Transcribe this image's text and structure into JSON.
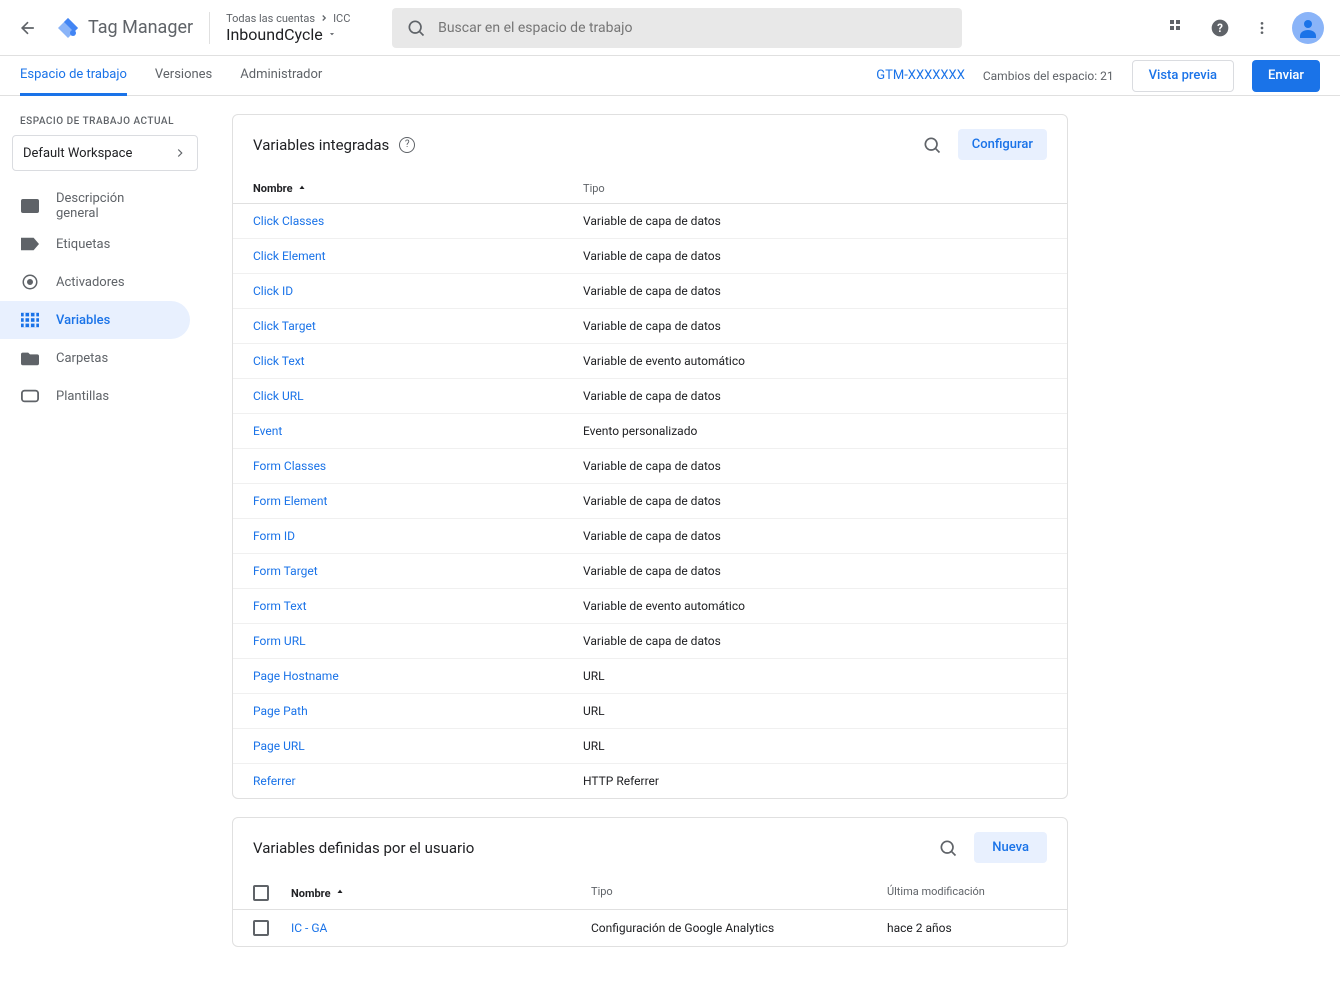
{
  "header": {
    "app_name": "Tag Manager",
    "breadcrumb_all": "Todas las cuentas",
    "breadcrumb_account": "ICC",
    "container_name": "InboundCycle",
    "search_placeholder": "Buscar en el espacio de trabajo"
  },
  "tabs": {
    "workspace": "Espacio de trabajo",
    "versions": "Versiones",
    "admin": "Administrador"
  },
  "subheader": {
    "container_id": "GTM-XXXXXXX",
    "changes_label": "Cambios del espacio: 21",
    "preview": "Vista previa",
    "submit": "Enviar"
  },
  "sidebar": {
    "ws_label": "ESPACIO DE TRABAJO ACTUAL",
    "ws_name": "Default Workspace",
    "items": [
      {
        "label": "Descripción general"
      },
      {
        "label": "Etiquetas"
      },
      {
        "label": "Activadores"
      },
      {
        "label": "Variables"
      },
      {
        "label": "Carpetas"
      },
      {
        "label": "Plantillas"
      }
    ]
  },
  "builtin": {
    "title": "Variables integradas",
    "configure": "Configurar",
    "cols": {
      "name": "Nombre",
      "type": "Tipo"
    },
    "rows": [
      {
        "name": "Click Classes",
        "type": "Variable de capa de datos"
      },
      {
        "name": "Click Element",
        "type": "Variable de capa de datos"
      },
      {
        "name": "Click ID",
        "type": "Variable de capa de datos"
      },
      {
        "name": "Click Target",
        "type": "Variable de capa de datos"
      },
      {
        "name": "Click Text",
        "type": "Variable de evento automático"
      },
      {
        "name": "Click URL",
        "type": "Variable de capa de datos"
      },
      {
        "name": "Event",
        "type": "Evento personalizado"
      },
      {
        "name": "Form Classes",
        "type": "Variable de capa de datos"
      },
      {
        "name": "Form Element",
        "type": "Variable de capa de datos"
      },
      {
        "name": "Form ID",
        "type": "Variable de capa de datos"
      },
      {
        "name": "Form Target",
        "type": "Variable de capa de datos"
      },
      {
        "name": "Form Text",
        "type": "Variable de evento automático"
      },
      {
        "name": "Form URL",
        "type": "Variable de capa de datos"
      },
      {
        "name": "Page Hostname",
        "type": "URL"
      },
      {
        "name": "Page Path",
        "type": "URL"
      },
      {
        "name": "Page URL",
        "type": "URL"
      },
      {
        "name": "Referrer",
        "type": "HTTP Referrer"
      }
    ]
  },
  "user": {
    "title": "Variables definidas por el usuario",
    "new": "Nueva",
    "cols": {
      "name": "Nombre",
      "type": "Tipo",
      "mod": "Última modificación"
    },
    "rows": [
      {
        "name": "IC - GA",
        "type": "Configuración de Google Analytics",
        "mod": "hace 2 años"
      }
    ]
  }
}
